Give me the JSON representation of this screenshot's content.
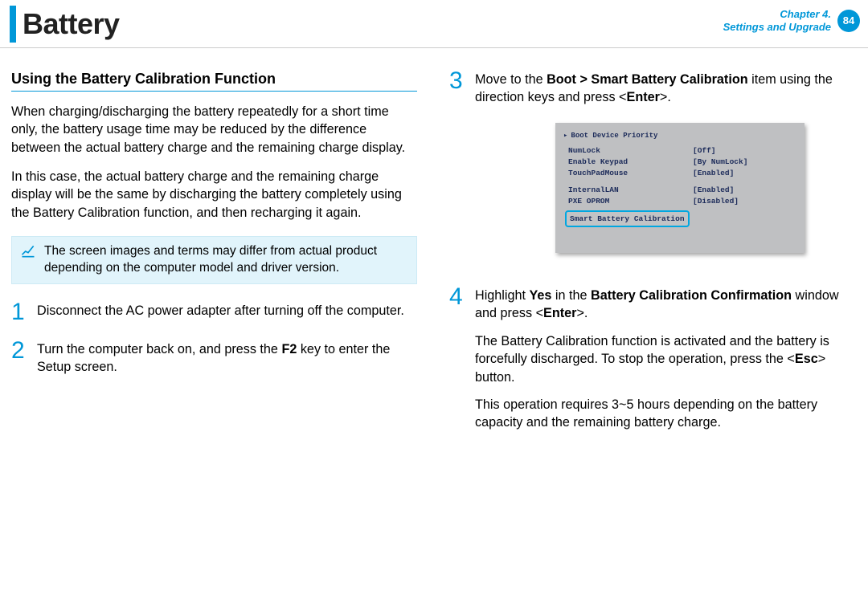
{
  "header": {
    "title": "Battery",
    "chapter_line1": "Chapter 4.",
    "chapter_line2": "Settings and Upgrade",
    "page_number": "84"
  },
  "left": {
    "section_heading": "Using the Battery Calibration Function",
    "para1": "When charging/discharging the battery repeatedly for a short time only, the battery usage time may be reduced by the difference between the actual battery charge and the remaining charge display.",
    "para2": "In this case, the actual battery charge and the remaining charge display will be the same by discharging the battery completely using the Battery Calibration function, and then recharging it again.",
    "note": "The screen images and terms may differ from actual product depending on the computer model and driver version.",
    "steps": [
      {
        "num": "1",
        "text_pre": "Disconnect the AC power adapter after turning off the computer."
      },
      {
        "num": "2",
        "text_pre": "Turn the computer back on, and press the ",
        "bold1": "F2",
        "text_post": " key to enter the Setup screen."
      }
    ]
  },
  "right": {
    "step3": {
      "num": "3",
      "pre": "Move to the ",
      "bold_path": "Boot > Smart Battery Calibration",
      "mid": " item using the direction keys and press <",
      "bold_enter": "Enter",
      "post": ">."
    },
    "bios": {
      "head": "Boot Device Priority",
      "rows_a": [
        {
          "k": "NumLock",
          "v": "[Off]"
        },
        {
          "k": "Enable Keypad",
          "v": "[By NumLock]"
        },
        {
          "k": "TouchPadMouse",
          "v": "[Enabled]"
        }
      ],
      "rows_b": [
        {
          "k": "InternalLAN",
          "v": "[Enabled]"
        },
        {
          "k": "PXE OPROM",
          "v": "[Disabled]"
        }
      ],
      "highlight": "Smart Battery Calibration"
    },
    "step4": {
      "num": "4",
      "p1_pre": "Highlight ",
      "p1_b1": "Yes",
      "p1_mid": " in the ",
      "p1_b2": "Battery Calibration Confirmation",
      "p1_mid2": " window and press <",
      "p1_b3": "Enter",
      "p1_post": ">.",
      "p2_pre": "The Battery Calibration function is activated and the battery is forcefully discharged. To stop the operation, press the <",
      "p2_b": "Esc",
      "p2_post": "> button.",
      "p3": "This operation requires 3~5 hours depending on the battery capacity and the remaining battery charge."
    }
  }
}
